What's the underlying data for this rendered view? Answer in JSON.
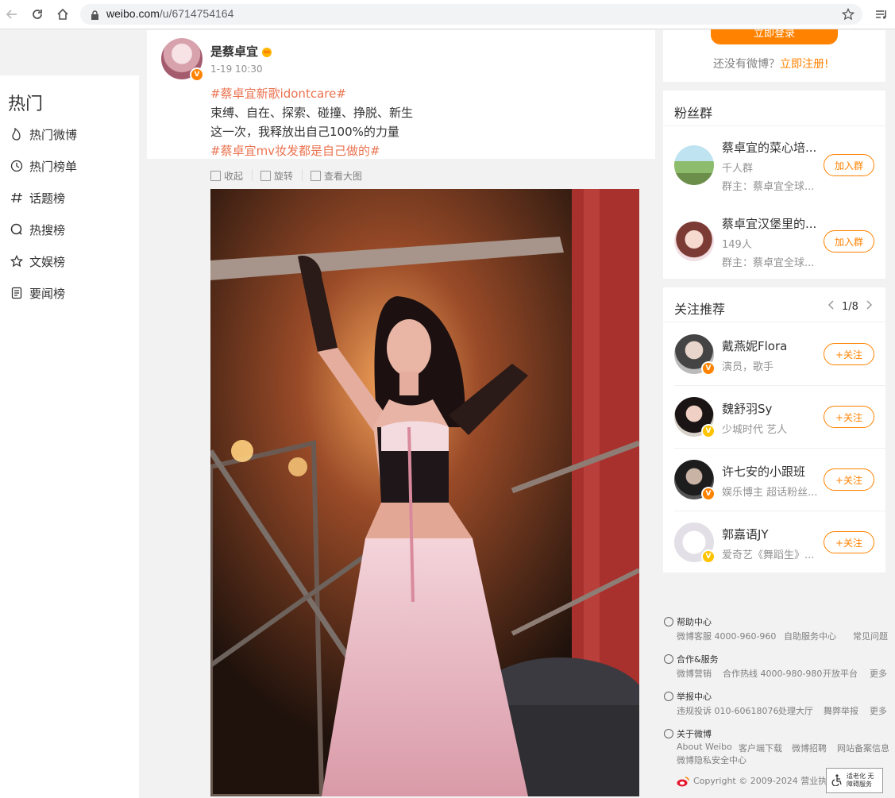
{
  "browser": {
    "url_domain": "weibo.com",
    "url_path": "/u/6714754164"
  },
  "sidebar": {
    "title": "热门",
    "items": [
      {
        "label": "热门微博",
        "icon": "fire-icon"
      },
      {
        "label": "热门榜单",
        "icon": "clock-icon"
      },
      {
        "label": "话题榜",
        "icon": "hashtag-icon"
      },
      {
        "label": "热搜榜",
        "icon": "search-icon"
      },
      {
        "label": "文娱榜",
        "icon": "star-icon"
      },
      {
        "label": "要闻榜",
        "icon": "news-icon"
      }
    ]
  },
  "post": {
    "author": "是蔡卓宜",
    "time": "1-19 10:30",
    "lines": [
      "#蔡卓宜新歌idontcare#",
      "束缚、自在、探索、碰撞、挣脱、新生",
      "这一次，我释放出自己100%的力量",
      "#蔡卓宜mv妆发都是自己做的#"
    ],
    "toolbar": {
      "collapse": "收起",
      "rotate": "旋转",
      "view_large": "查看大图"
    }
  },
  "login": {
    "button": "立即登录",
    "prompt": "还没有微博？",
    "register": "立即注册!"
  },
  "fan_groups": {
    "title": "粉丝群",
    "groups": [
      {
        "name": "蔡卓宜的菜心培...",
        "size": "千人群",
        "owner": "群主：蔡卓宜全球...",
        "action": "加入群"
      },
      {
        "name": "蔡卓宜汉堡里的...",
        "size": "149人",
        "owner": "群主：蔡卓宜全球...",
        "action": "加入群"
      }
    ]
  },
  "recommend": {
    "title": "关注推荐",
    "page": "1/8",
    "users": [
      {
        "name": "戴燕妮Flora",
        "desc": "演员，歌手",
        "action": "+关注",
        "badge": "V"
      },
      {
        "name": "魏舒羽Sy",
        "desc": "少城时代 艺人",
        "action": "+关注",
        "badge": "V"
      },
      {
        "name": "许七安的小跟班",
        "desc": "娱乐博主 超话粉丝...",
        "action": "+关注",
        "badge": "V"
      },
      {
        "name": "郭嘉语JY",
        "desc": "爱奇艺《舞蹈生》...",
        "action": "+关注",
        "badge": "V"
      }
    ]
  },
  "footer": {
    "help": {
      "title": "帮助中心",
      "links": [
        "微博客服 4000-960-960",
        "自助服务中心",
        "常见问题"
      ]
    },
    "coop": {
      "title": "合作&服务",
      "links": [
        "微博营销",
        "合作热线 4000-980-980",
        "开放平台",
        "更多"
      ]
    },
    "report": {
      "title": "举报中心",
      "links": [
        "违规投诉 010-60618076",
        "处理大厅",
        "舞弊举报",
        "更多"
      ]
    },
    "about": {
      "title": "关于微博",
      "links": [
        "About Weibo",
        "客户端下载",
        "微博招聘",
        "网站备案信息"
      ],
      "extra": "微博隐私安全中心"
    },
    "copyright": "Copyright © 2009-2024 营业执照",
    "accessibility": "适老化 无障碍服务"
  }
}
